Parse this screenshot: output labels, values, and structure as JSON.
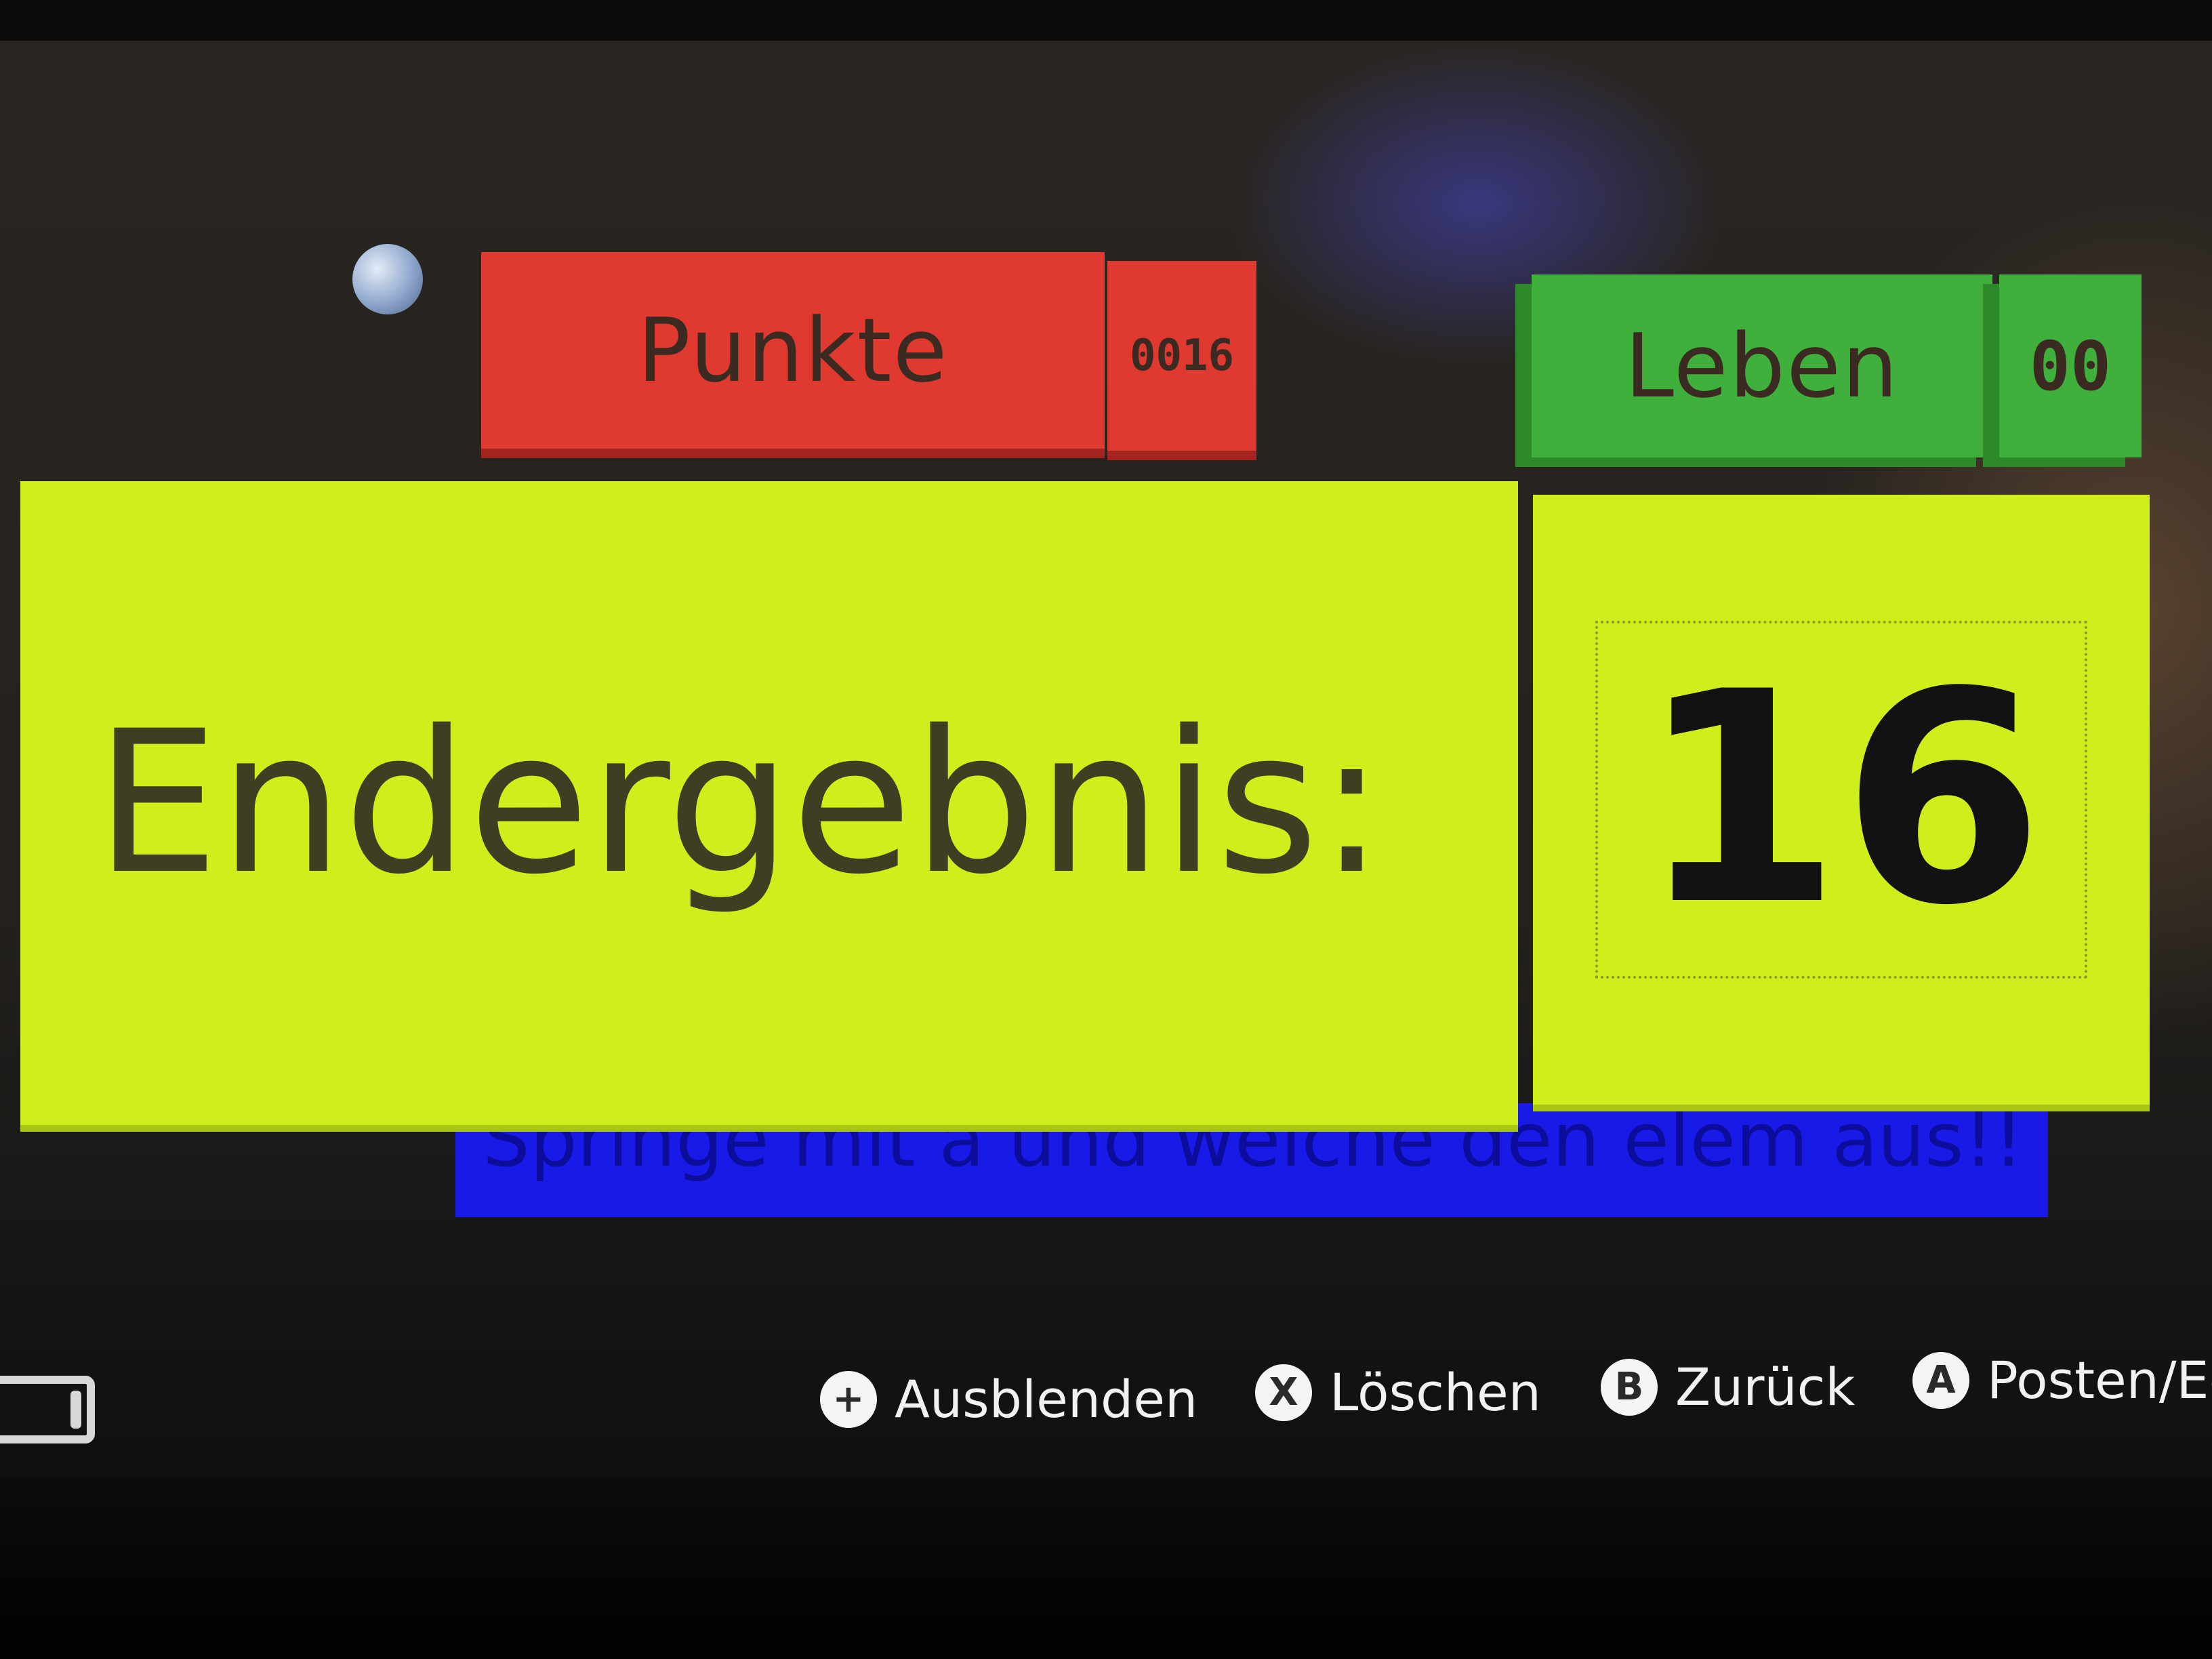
{
  "hud": {
    "score_label": "Punkte",
    "score_value": "0016",
    "lives_label": "Leben",
    "lives_value": "00"
  },
  "result": {
    "label": "Endergebnis:",
    "value": "16"
  },
  "instruction_bar": {
    "text": "Springe mit a und weiche den elem aus!!"
  },
  "controls": [
    {
      "button": "+",
      "label": "Ausblenden"
    },
    {
      "button": "X",
      "label": "Löschen"
    },
    {
      "button": "B",
      "label": "Zurück"
    },
    {
      "button": "A",
      "label": "Posten/Ed"
    }
  ],
  "colors": {
    "score_panel": "#e0392f",
    "lives_panel": "#3fb03b",
    "result_panel": "#cfee1c",
    "instruction_bar": "#1a1ae8"
  },
  "icons": [
    "orb-icon",
    "console-icon"
  ]
}
